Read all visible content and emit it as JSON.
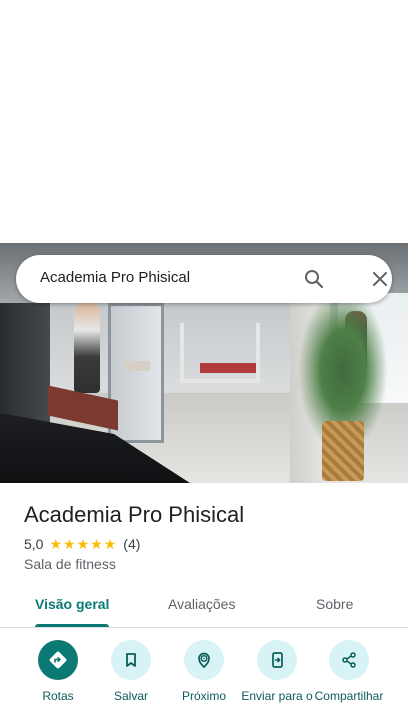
{
  "search": {
    "query": "Academia Pro Phisical",
    "search_icon": "search-icon",
    "close_icon": "close-icon"
  },
  "place": {
    "title": "Academia Pro Phisical",
    "rating": "5,0",
    "stars": 5,
    "review_count": "(4)",
    "category": "Sala de fitness"
  },
  "tabs": [
    {
      "label": "Visão geral",
      "active": true
    },
    {
      "label": "Avaliações",
      "active": false
    },
    {
      "label": "Sobre",
      "active": false
    }
  ],
  "actions": [
    {
      "label": "Rotas",
      "icon": "directions-icon"
    },
    {
      "label": "Salvar",
      "icon": "bookmark-icon"
    },
    {
      "label": "Próximo",
      "icon": "nearby-icon"
    },
    {
      "label": "Enviar para o",
      "icon": "send-to-phone-icon"
    },
    {
      "label": "Compartilhar",
      "icon": "share-icon"
    }
  ],
  "colors": {
    "accent": "#0b7a75",
    "action_bg": "#d7f3f5",
    "star": "#fbbc04"
  }
}
